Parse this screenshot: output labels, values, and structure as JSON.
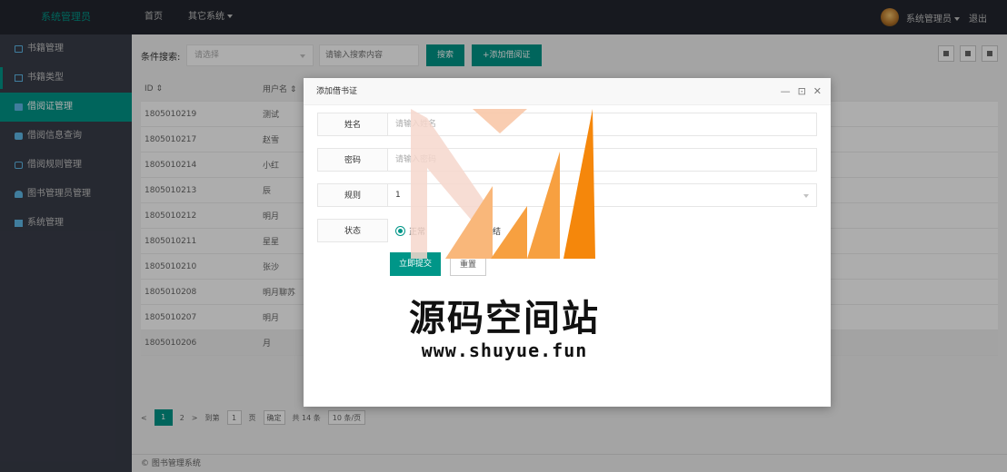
{
  "header": {
    "logo": "系统管理员",
    "nav": [
      {
        "label": "首页"
      },
      {
        "label": "其它系统"
      }
    ],
    "user": "系统管理员",
    "logout": "退出"
  },
  "sidebar": {
    "items": [
      {
        "label": "书籍管理",
        "icon": "book-icon"
      },
      {
        "label": "书籍类型",
        "icon": "doc-icon"
      },
      {
        "label": "借阅证管理",
        "icon": "card-icon"
      },
      {
        "label": "借阅信息查询",
        "icon": "message-icon"
      },
      {
        "label": "借阅规则管理",
        "icon": "note-icon"
      },
      {
        "label": "图书管理员管理",
        "icon": "users-icon"
      },
      {
        "label": "系统管理",
        "icon": "grid-icon"
      }
    ]
  },
  "toolbar": {
    "label": "条件搜索:",
    "select_placeholder": "请选择",
    "search_placeholder": "请输入搜索内容",
    "search_button": "搜索",
    "add_button": "+添加借阅证"
  },
  "table": {
    "headers": [
      "ID ⇕",
      "用户名 ⇕"
    ],
    "rows": [
      [
        "1805010219",
        "测试"
      ],
      [
        "1805010217",
        "赵雪"
      ],
      [
        "1805010214",
        "小红"
      ],
      [
        "1805010213",
        "辰"
      ],
      [
        "1805010212",
        "明月"
      ],
      [
        "1805010211",
        "星星"
      ],
      [
        "1805010210",
        "张沙"
      ],
      [
        "1805010208",
        "明月聊苏"
      ],
      [
        "1805010207",
        "明月"
      ],
      [
        "1805010206",
        "月"
      ]
    ]
  },
  "pager": {
    "prev": "<",
    "current": "1",
    "next_page": "2",
    "next": ">",
    "goto": "到第",
    "page_input": "1",
    "page_unit": "页",
    "confirm": "确定",
    "total": "共 14 条",
    "per_page": "10 条/页"
  },
  "footer": {
    "text": "© 图书管理系统"
  },
  "modal": {
    "title": "添加借书证",
    "controls": [
      "—",
      "⊡",
      "✕"
    ],
    "fields": [
      {
        "label": "姓名",
        "placeholder": "请输入姓名"
      },
      {
        "label": "密码",
        "placeholder": "请输入密码"
      },
      {
        "label": "规则",
        "value": "1"
      },
      {
        "label": "状态",
        "options": [
          "正常",
          "冻结"
        ]
      }
    ],
    "submit": "立即提交",
    "reset": "重置"
  },
  "watermark": {
    "text": "源码空间站",
    "url": "www.shuyue.fun"
  }
}
